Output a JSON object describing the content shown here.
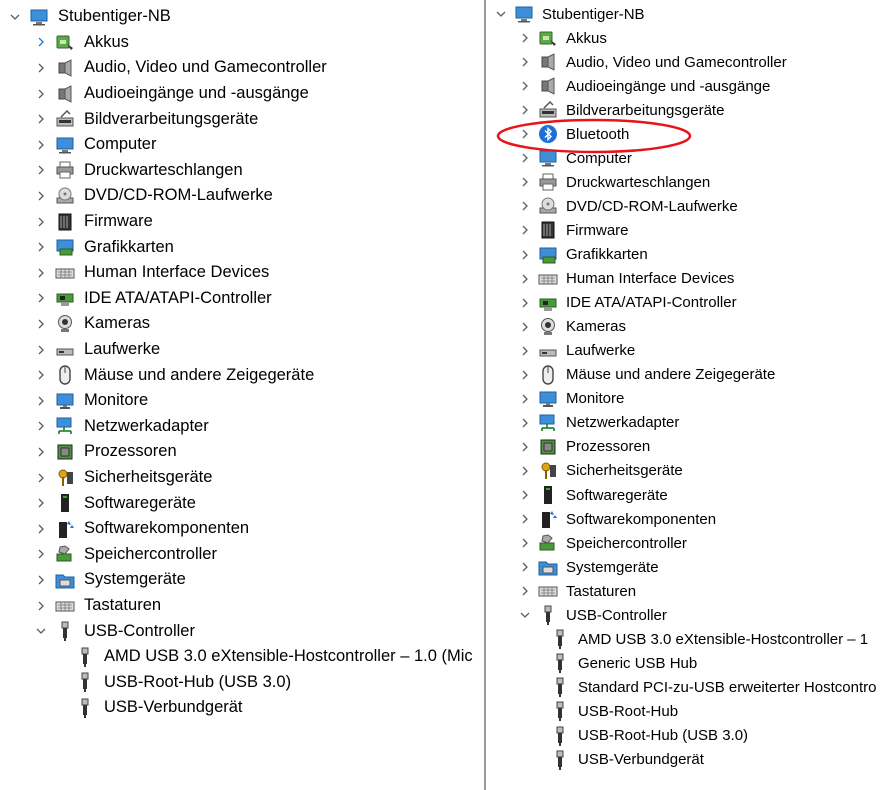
{
  "left_tree": {
    "root": "Stubentiger-NB",
    "categories": [
      {
        "label": "Akkus",
        "icon": "battery-icon"
      },
      {
        "label": "Audio, Video und Gamecontroller",
        "icon": "speaker-icon"
      },
      {
        "label": "Audioeingänge und -ausgänge",
        "icon": "speaker-icon"
      },
      {
        "label": "Bildverarbeitungsgeräte",
        "icon": "scanner-icon"
      },
      {
        "label": "Computer",
        "icon": "computer-icon"
      },
      {
        "label": "Druckwarteschlangen",
        "icon": "printer-icon"
      },
      {
        "label": "DVD/CD-ROM-Laufwerke",
        "icon": "optical-drive-icon"
      },
      {
        "label": "Firmware",
        "icon": "chip-icon"
      },
      {
        "label": "Grafikkarten",
        "icon": "display-adapter-icon"
      },
      {
        "label": "Human Interface Devices",
        "icon": "keyboard-icon"
      },
      {
        "label": "IDE ATA/ATAPI-Controller",
        "icon": "controller-card-icon"
      },
      {
        "label": "Kameras",
        "icon": "webcam-icon"
      },
      {
        "label": "Laufwerke",
        "icon": "disk-drive-icon"
      },
      {
        "label": "Mäuse und andere Zeigegeräte",
        "icon": "mouse-icon"
      },
      {
        "label": "Monitore",
        "icon": "monitor-icon"
      },
      {
        "label": "Netzwerkadapter",
        "icon": "network-icon"
      },
      {
        "label": "Prozessoren",
        "icon": "processor-icon"
      },
      {
        "label": "Sicherheitsgeräte",
        "icon": "security-key-icon"
      },
      {
        "label": "Softwaregeräte",
        "icon": "software-device-icon"
      },
      {
        "label": "Softwarekomponenten",
        "icon": "software-component-icon"
      },
      {
        "label": "Speichercontroller",
        "icon": "storage-controller-icon"
      },
      {
        "label": "Systemgeräte",
        "icon": "system-folder-icon"
      },
      {
        "label": "Tastaturen",
        "icon": "keyboard-icon"
      },
      {
        "label": "USB-Controller",
        "icon": "usb-icon"
      }
    ],
    "usb_children": [
      "AMD USB 3.0 eXtensible-Hostcontroller – 1.0 (Mic",
      "USB-Root-Hub (USB 3.0)",
      "USB-Verbundgerät"
    ]
  },
  "right_tree": {
    "root": "Stubentiger-NB",
    "categories": [
      {
        "label": "Akkus",
        "icon": "battery-icon"
      },
      {
        "label": "Audio, Video und Gamecontroller",
        "icon": "speaker-icon"
      },
      {
        "label": "Audioeingänge und -ausgänge",
        "icon": "speaker-icon"
      },
      {
        "label": "Bildverarbeitungsgeräte",
        "icon": "scanner-icon"
      },
      {
        "label": "Bluetooth",
        "icon": "bluetooth-icon"
      },
      {
        "label": "Computer",
        "icon": "computer-icon"
      },
      {
        "label": "Druckwarteschlangen",
        "icon": "printer-icon"
      },
      {
        "label": "DVD/CD-ROM-Laufwerke",
        "icon": "optical-drive-icon"
      },
      {
        "label": "Firmware",
        "icon": "chip-icon"
      },
      {
        "label": "Grafikkarten",
        "icon": "display-adapter-icon"
      },
      {
        "label": "Human Interface Devices",
        "icon": "keyboard-icon"
      },
      {
        "label": "IDE ATA/ATAPI-Controller",
        "icon": "controller-card-icon"
      },
      {
        "label": "Kameras",
        "icon": "webcam-icon"
      },
      {
        "label": "Laufwerke",
        "icon": "disk-drive-icon"
      },
      {
        "label": "Mäuse und andere Zeigegeräte",
        "icon": "mouse-icon"
      },
      {
        "label": "Monitore",
        "icon": "monitor-icon"
      },
      {
        "label": "Netzwerkadapter",
        "icon": "network-icon"
      },
      {
        "label": "Prozessoren",
        "icon": "processor-icon"
      },
      {
        "label": "Sicherheitsgeräte",
        "icon": "security-key-icon"
      },
      {
        "label": "Softwaregeräte",
        "icon": "software-device-icon"
      },
      {
        "label": "Softwarekomponenten",
        "icon": "software-component-icon"
      },
      {
        "label": "Speichercontroller",
        "icon": "storage-controller-icon"
      },
      {
        "label": "Systemgeräte",
        "icon": "system-folder-icon"
      },
      {
        "label": "Tastaturen",
        "icon": "keyboard-icon"
      },
      {
        "label": "USB-Controller",
        "icon": "usb-icon"
      }
    ],
    "usb_children": [
      "AMD USB 3.0 eXtensible-Hostcontroller – 1",
      "Generic USB Hub",
      "Standard PCI-zu-USB erweiterter Hostcontro",
      "USB-Root-Hub",
      "USB-Root-Hub (USB 3.0)",
      "USB-Verbundgerät"
    ]
  },
  "colors": {
    "highlight": "#e8141a",
    "chevron": "#5e5e5e",
    "divider": "#9a9a9a"
  }
}
